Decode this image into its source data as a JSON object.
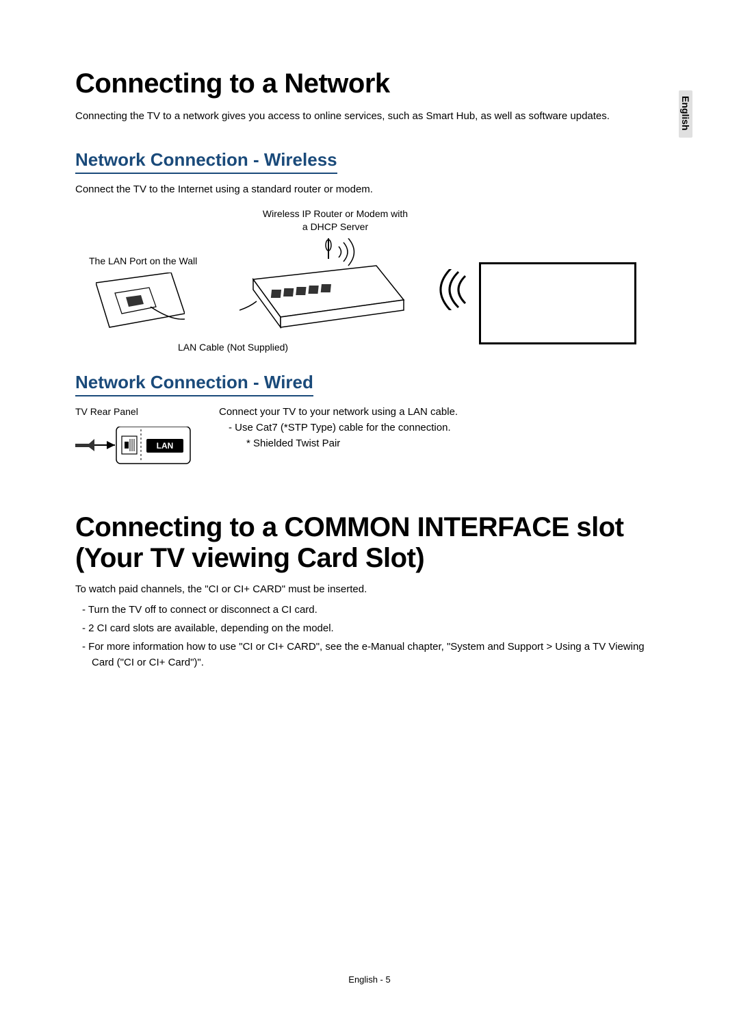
{
  "side_tab": "English",
  "h1_a": "Connecting to a Network",
  "intro_a": "Connecting the TV to a network gives you access to online services, such as Smart Hub, as well as software updates.",
  "h2_wireless": "Network Connection - Wireless",
  "wireless_sub": "Connect the TV to the Internet using a standard router or modem.",
  "router_label_l1": "Wireless IP Router or Modem with",
  "router_label_l2": "a DHCP Server",
  "wall_label": "The LAN Port on the Wall",
  "cable_note": "LAN Cable (Not Supplied)",
  "h2_wired": "Network Connection - Wired",
  "rear_label": "TV Rear Panel",
  "lan_badge": "LAN",
  "wired_p1": "Connect your TV to your network using a LAN cable.",
  "wired_b1": "-   Use Cat7 (*STP Type) cable for the connection.",
  "wired_b2": "* Shielded Twist Pair",
  "h1_b": "Connecting to a COMMON INTERFACE slot (Your TV viewing Card Slot)",
  "ci_intro": "To watch paid channels, the \"CI or CI+ CARD\" must be inserted.",
  "ci_li1": "Turn the TV off to connect or disconnect a CI card.",
  "ci_li2": "2 CI card slots are available, depending on the model.",
  "ci_li3": "For more information how to use \"CI or CI+ CARD\", see the e-Manual chapter, \"System and Support > Using a TV Viewing Card (\"CI or CI+ Card\")\".",
  "footer": "English - 5"
}
